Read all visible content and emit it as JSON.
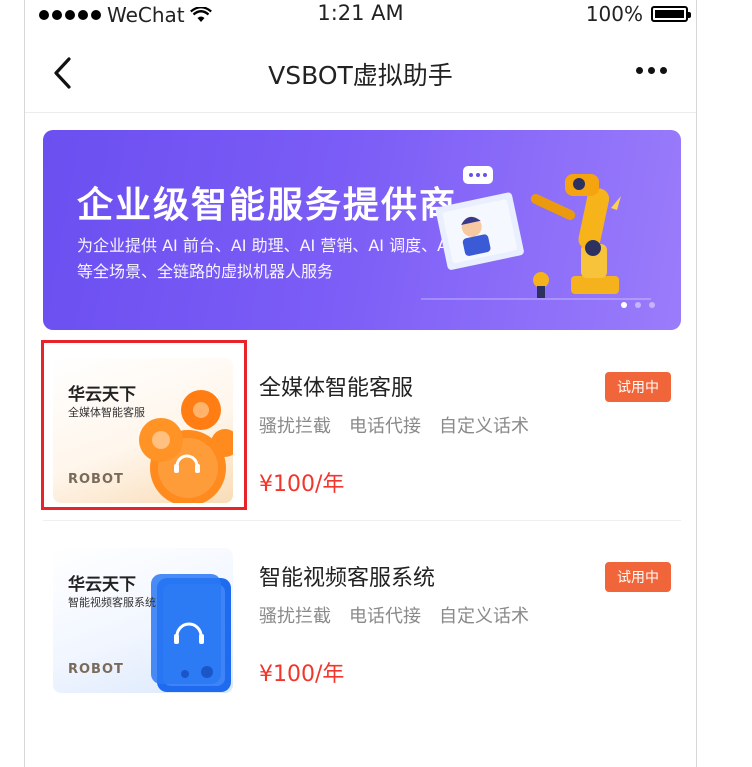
{
  "status_bar": {
    "carrier": "WeChat",
    "time": "1:21 AM",
    "battery": "100%"
  },
  "nav": {
    "title": "VSBOT虚拟助手",
    "back_icon": "chevron-left-icon",
    "more_icon": "more-dots-icon"
  },
  "banner": {
    "title": "企业级智能服务提供商",
    "subtitle": "为企业提供 AI 前台、AI 助理、AI 营销、AI 调度、AI 培训等全场景、全链路的虚拟机器人服务",
    "slides_count": 3,
    "active_slide": 1
  },
  "products": [
    {
      "thumb_brand": "华云天下",
      "thumb_subtitle": "全媒体智能客服",
      "thumb_robot": "ROBOT",
      "title": "全媒体智能客服",
      "tags": [
        "骚扰拦截",
        "电话代接",
        "自定义话术"
      ],
      "price": "¥100/年",
      "badge": "试用中",
      "highlighted": true
    },
    {
      "thumb_brand": "华云天下",
      "thumb_subtitle": "智能视频客服系统",
      "thumb_robot": "ROBOT",
      "title": "智能视频客服系统",
      "tags": [
        "骚扰拦截",
        "电话代接",
        "自定义话术"
      ],
      "price": "¥100/年",
      "badge": "试用中",
      "highlighted": false
    }
  ],
  "colors": {
    "banner_start": "#6b4ff0",
    "price": "#f2362c",
    "badge": "#f0663a",
    "highlight": "#e8242a"
  }
}
